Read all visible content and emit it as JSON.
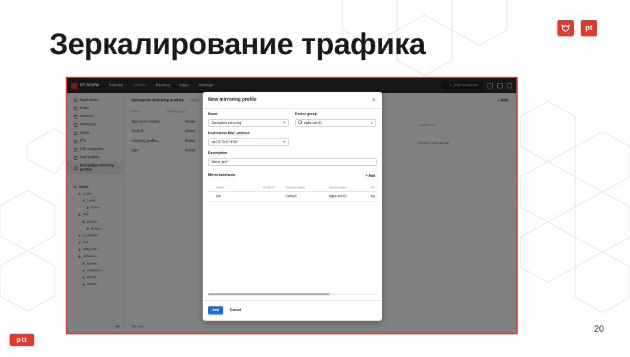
{
  "slide": {
    "title": "Зеркалирование трафика",
    "number": "20",
    "logo_left": "ptt",
    "logo_right": "pt"
  },
  "app": {
    "brand": "PT NGFW",
    "nav": [
      "Policies",
      "Objects",
      "Devices",
      "Logs",
      "Settings"
    ],
    "push_label": "Push to devices",
    "sidebar": {
      "items": [
        "Applications",
        "Users",
        "Services",
        "Addresses",
        "Zones",
        "IPS",
        "URL categories",
        "Auth profiles",
        "Decryption mirroring profiles"
      ],
      "tree": [
        "Global",
        "1.new",
        "2.new",
        "3.new",
        "Test",
        "product",
        "produc...",
        "3.4.test981",
        "342",
        "Abby_Sch...",
        "Adrasmo...",
        "Dynam...",
        "Anderson...",
        "Bee74",
        "Harvey"
      ],
      "footer": "+4"
    },
    "main": {
      "header": "Decryption mirroring profiles",
      "header_tab": "Histo",
      "add_label": "+ Add",
      "col_name": "Name",
      "col_group": "Device group",
      "col_date": "Updated on",
      "rows": [
        {
          "name": "Test mirror interfac",
          "group": "Global"
        },
        {
          "name": "Test123",
          "group": "Global"
        },
        {
          "name": "mirroring_profiles...",
          "group": "Global"
        },
        {
          "name": "pqev",
          "group": "Global"
        }
      ],
      "date_value": "8/27/24, 10:47:12 AM",
      "footer": "Tot rows"
    }
  },
  "modal": {
    "title": "New mirroring profile",
    "close": "×",
    "name_label": "Name",
    "name_value": "Dscription mirroring",
    "group_label": "Device group",
    "group_value": "ngfw-virt-01",
    "mac_label": "Destination MAC address",
    "mac_value": "ab:23:70:67:ff:30",
    "desc_label": "Description",
    "desc_value": "Mirror prof",
    "mi_label": "Mirror interfaces",
    "mi_add": "+ Add",
    "mi_cols": [
      "Name",
      "VLAN ID",
      "Virtual context",
      "Device name",
      "De"
    ],
    "mi_rows": [
      {
        "name": "lan",
        "vlan": "",
        "vctx": "Default",
        "device": "ngfw-virt-01",
        "extra": "ng"
      }
    ],
    "add_button": "Add",
    "cancel_button": "Cancel"
  }
}
